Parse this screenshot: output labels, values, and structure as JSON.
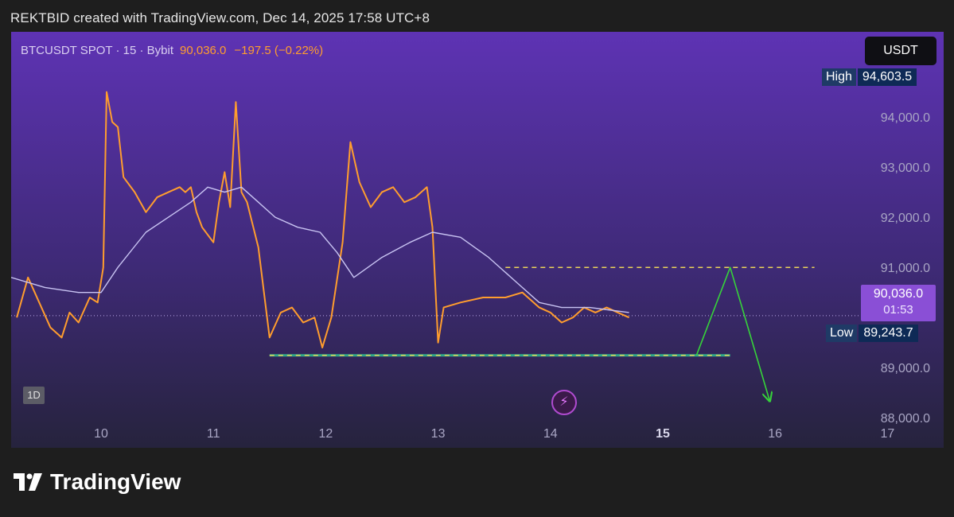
{
  "header": {
    "caption": "REKTBID created with TradingView.com, Dec 14, 2025 17:58 UTC+8"
  },
  "legend": {
    "symbol": "BTCUSDT SPOT · 15 · Bybit",
    "price": "90,036.0",
    "change": "−197.5 (−0.22%)"
  },
  "currency_button": "USDT",
  "badges": {
    "high_label": "High",
    "high_value": "94,603.5",
    "low_label": "Low",
    "low_value": "89,243.7",
    "last_value": "90,036.0",
    "countdown": "01:53"
  },
  "interval_tag": "1D",
  "footer": {
    "brand": "TradingView"
  },
  "icons": {
    "flash": "lightning-icon"
  },
  "colors": {
    "price_line": "#ff9d2e",
    "ma_line": "#c8c3f2",
    "resistance": "#e9d25a",
    "support": "#e9d25a",
    "projection": "#36d33a"
  },
  "chart_data": {
    "type": "line",
    "xlabel": "",
    "ylabel": "",
    "x_tick_labels": [
      "10",
      "11",
      "12",
      "13",
      "14",
      "15",
      "16",
      "17"
    ],
    "y_tick_labels": [
      "94,000.0",
      "93,000.0",
      "92,000.0",
      "91,000.0",
      "89,000.0",
      "88,000.0"
    ],
    "y_ticks": [
      94000,
      93000,
      92000,
      91000,
      89000,
      88000
    ],
    "x_range": [
      9.2,
      17.5
    ],
    "ylim": [
      87400,
      95700
    ],
    "grid": false,
    "series": [
      {
        "style": "price",
        "points": [
          [
            9.25,
            90000
          ],
          [
            9.35,
            90800
          ],
          [
            9.45,
            90300
          ],
          [
            9.55,
            89800
          ],
          [
            9.65,
            89600
          ],
          [
            9.72,
            90100
          ],
          [
            9.8,
            89900
          ],
          [
            9.9,
            90400
          ],
          [
            9.97,
            90300
          ],
          [
            10.02,
            91000
          ],
          [
            10.05,
            94500
          ],
          [
            10.1,
            93900
          ],
          [
            10.15,
            93800
          ],
          [
            10.2,
            92800
          ],
          [
            10.3,
            92500
          ],
          [
            10.4,
            92100
          ],
          [
            10.5,
            92400
          ],
          [
            10.6,
            92500
          ],
          [
            10.7,
            92600
          ],
          [
            10.75,
            92500
          ],
          [
            10.8,
            92600
          ],
          [
            10.85,
            92100
          ],
          [
            10.9,
            91800
          ],
          [
            11.0,
            91500
          ],
          [
            11.05,
            92300
          ],
          [
            11.1,
            92900
          ],
          [
            11.15,
            92200
          ],
          [
            11.2,
            94300
          ],
          [
            11.25,
            92500
          ],
          [
            11.3,
            92300
          ],
          [
            11.4,
            91400
          ],
          [
            11.5,
            89600
          ],
          [
            11.6,
            90100
          ],
          [
            11.7,
            90200
          ],
          [
            11.8,
            89900
          ],
          [
            11.9,
            90000
          ],
          [
            11.97,
            89400
          ],
          [
            12.05,
            90000
          ],
          [
            12.15,
            91500
          ],
          [
            12.22,
            93500
          ],
          [
            12.3,
            92700
          ],
          [
            12.4,
            92200
          ],
          [
            12.5,
            92500
          ],
          [
            12.6,
            92600
          ],
          [
            12.7,
            92300
          ],
          [
            12.8,
            92400
          ],
          [
            12.9,
            92600
          ],
          [
            12.95,
            91800
          ],
          [
            13.0,
            89500
          ],
          [
            13.05,
            90200
          ],
          [
            13.2,
            90300
          ],
          [
            13.4,
            90400
          ],
          [
            13.6,
            90400
          ],
          [
            13.75,
            90500
          ],
          [
            13.9,
            90200
          ],
          [
            14.0,
            90100
          ],
          [
            14.1,
            89900
          ],
          [
            14.2,
            90000
          ],
          [
            14.3,
            90200
          ],
          [
            14.4,
            90100
          ],
          [
            14.5,
            90200
          ],
          [
            14.6,
            90100
          ],
          [
            14.7,
            90000
          ]
        ]
      },
      {
        "style": "moving-average",
        "points": [
          [
            9.2,
            90800
          ],
          [
            9.5,
            90600
          ],
          [
            9.8,
            90500
          ],
          [
            10.0,
            90500
          ],
          [
            10.15,
            91000
          ],
          [
            10.4,
            91700
          ],
          [
            10.6,
            92000
          ],
          [
            10.8,
            92300
          ],
          [
            10.95,
            92600
          ],
          [
            11.1,
            92500
          ],
          [
            11.25,
            92600
          ],
          [
            11.4,
            92300
          ],
          [
            11.55,
            92000
          ],
          [
            11.75,
            91800
          ],
          [
            11.95,
            91700
          ],
          [
            12.1,
            91300
          ],
          [
            12.25,
            90800
          ],
          [
            12.5,
            91200
          ],
          [
            12.75,
            91500
          ],
          [
            12.95,
            91700
          ],
          [
            13.2,
            91600
          ],
          [
            13.45,
            91200
          ],
          [
            13.7,
            90700
          ],
          [
            13.9,
            90300
          ],
          [
            14.1,
            90200
          ],
          [
            14.35,
            90200
          ],
          [
            14.7,
            90100
          ]
        ]
      },
      {
        "style": "resistance",
        "points": [
          [
            13.6,
            91000
          ],
          [
            16.35,
            91000
          ]
        ]
      },
      {
        "style": "support",
        "points": [
          [
            11.5,
            89243.7
          ],
          [
            15.6,
            89243.7
          ]
        ]
      },
      {
        "style": "projection",
        "points": [
          [
            15.3,
            89243.7
          ],
          [
            15.6,
            91000
          ],
          [
            15.95,
            88350
          ]
        ]
      }
    ]
  }
}
